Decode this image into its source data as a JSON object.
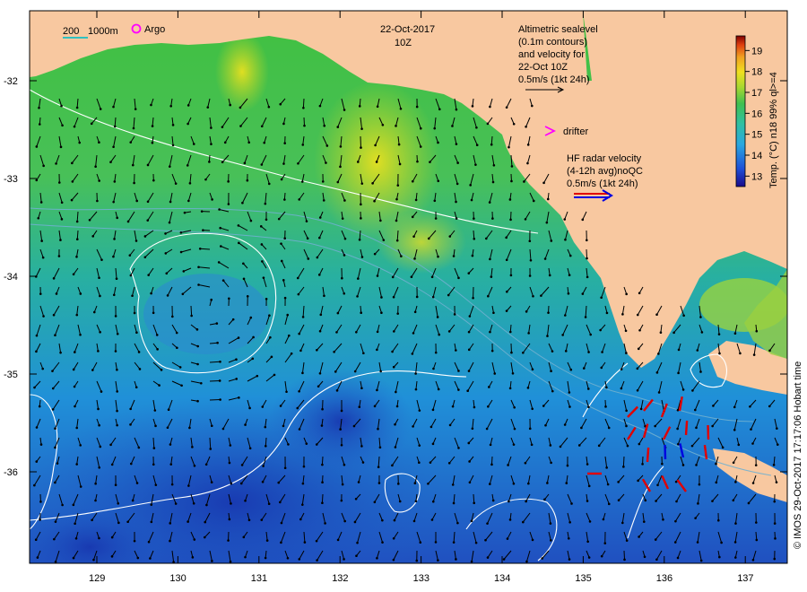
{
  "header": {
    "date": "22-Oct-2017",
    "time": "10Z"
  },
  "scale_bar": {
    "label_200": "200",
    "label_1000": "1000m",
    "argo_label": "Argo"
  },
  "altimetry": {
    "line1": "Altimetric sealevel",
    "line2": "(0.1m contours)",
    "line3": "and velocity for",
    "line4": "22-Oct 10Z",
    "line5": "0.5m/s (1kt 24h)"
  },
  "drifter": {
    "label": "drifter"
  },
  "hf_radar": {
    "line1": "HF radar velocity",
    "line2": "(4-12h avg)noQC",
    "line3": "0.5m/s (1kt 24h)"
  },
  "colorbar": {
    "title": "Temp. (°C) n18 99% ql>=4",
    "ticks": [
      "13",
      "14",
      "15",
      "16",
      "17",
      "18",
      "19"
    ],
    "range": [
      12.5,
      19.7
    ]
  },
  "copyright": "© IMOS 29-Oct-2017 17:17:06 Hobart time",
  "axes": {
    "y_ticks": [
      "-32",
      "-33",
      "-34",
      "-35",
      "-36"
    ],
    "x_ticks": [
      "129",
      "130",
      "131",
      "132",
      "133",
      "134",
      "135",
      "136",
      "137"
    ]
  },
  "colors": {
    "land": "#f8c8a0",
    "sea_cool": "#2050c0",
    "sea_warm": "#d8d820",
    "altimetry_arrow": "#000000",
    "hf_red": "#e00000",
    "hf_blue": "#0000e0",
    "argo": "#ff00ff",
    "drifter": "#ff00ff",
    "contour": "#ffffff",
    "isobath": "#70b0d0"
  }
}
